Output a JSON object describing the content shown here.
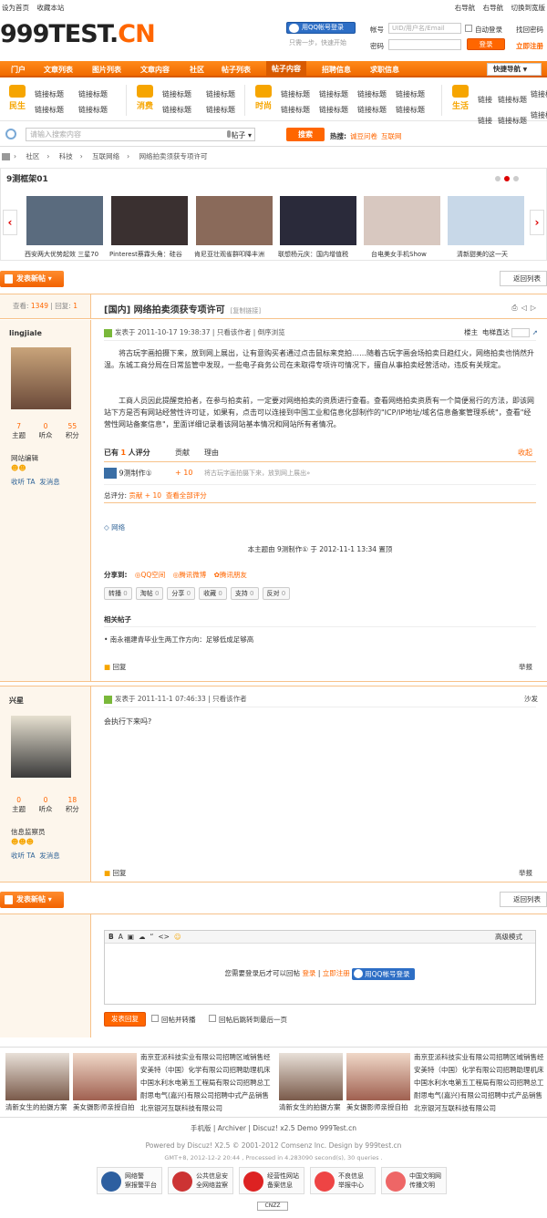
{
  "topbar": {
    "left": [
      "设为首页",
      "收藏本站"
    ],
    "right": [
      "右导航",
      "右导航",
      "切换到宽版"
    ]
  },
  "logo": {
    "main": "999TEST.",
    "accent": "CN"
  },
  "login": {
    "qq_button": "用QQ帐号登录",
    "qq_sub": "只需一步，快速开始",
    "account_label": "帐号",
    "account_placeholder": "UID/用户名/Email",
    "auto_login": "自动登录",
    "retrieve_password": "找回密码",
    "password_label": "密码",
    "login_button": "登录",
    "register": "立即注册"
  },
  "nav": {
    "items": [
      "门户",
      "文章列表",
      "图片列表",
      "文章内容",
      "社区",
      "帖子列表",
      "帖子内容",
      "招聘信息",
      "求职信息"
    ],
    "active_index": 6,
    "quick_nav": "快捷导航"
  },
  "categories": [
    {
      "name": "民生",
      "icon": "people-icon",
      "links": [
        "链接标题",
        "链接标题",
        "链接标题",
        "链接标题"
      ]
    },
    {
      "name": "消费",
      "icon": "cart-icon",
      "links": [
        "链接标题",
        "链接标题",
        "链接标题",
        "链接标题"
      ]
    },
    {
      "name": "时尚",
      "icon": "camera-icon",
      "links": [
        "链接标题",
        "链接标题",
        "链接标题",
        "链接标题",
        "链接标题",
        "链接标题",
        "链接标题",
        "链接标题"
      ]
    },
    {
      "name": "生活",
      "icon": "house-icon",
      "links": [
        "链接",
        "链接标题",
        "链接标题",
        "链接",
        "链接标题",
        "链接标题"
      ]
    }
  ],
  "search": {
    "placeholder": "请输入搜索内容",
    "type": "帖子",
    "button": "搜索",
    "hot_label": "热搜:",
    "hot": [
      "诚豆问卷",
      "互联网"
    ]
  },
  "breadcrumb": [
    "社区",
    "科技",
    "互联网络",
    "网络拍卖须获专项许可"
  ],
  "carousel": {
    "title": "9测框架01",
    "captions": [
      "西安两大优势起效 三星70",
      "Pinterest蔡霖头角：硅谷",
      "肯尼亚壮观雀群叩降丰洲",
      "联想杨元庆：国内增值税",
      "台电美女手机Show",
      "清新甜美的这一天"
    ],
    "thumb_colors": [
      "#5a6b7e",
      "#3a3030",
      "#8a6a5a",
      "#2a2a3a",
      "#d8c8c0",
      "#c8d8e8"
    ]
  },
  "actions": {
    "new_post": "发表新帖",
    "back_to_list": "返回列表"
  },
  "thread": {
    "views_label": "查看:",
    "views": "1349",
    "replies_label": "回复:",
    "replies": "1",
    "category": "[国内]",
    "title": "网络拍卖须获专项许可",
    "copy_link": "[复制链接]"
  },
  "post1": {
    "author": "lingjiale",
    "stats": [
      {
        "v": "7",
        "k": "主题"
      },
      {
        "v": "0",
        "k": "听众"
      },
      {
        "v": "55",
        "k": "积分"
      }
    ],
    "rank": "网站编辑",
    "follow": "收听 TA",
    "message": "发消息",
    "posted": "发表于 2011-10-17 19:38:37",
    "only_author": "只看该作者",
    "reverse": "倒序浏览",
    "floor": "楼主",
    "elevator": "电梯直达",
    "para1": "将古玩字画拍摄下来，放到网上展出，让有意购买者通过点击鼠标来竞拍……随着古玩字画会场拍卖日趋红火，网络拍卖也悄然升温。东城工商分局在日常监管中发现，一些电子商务公司在未取得专项许可情况下，擅自从事拍卖经营活动，违反有关规定。",
    "para2": "工商人员因此提醒竞拍者，在参与拍卖前，一定要对网络拍卖的资质进行查看。查看网络拍卖资质有一个简便易行的方法，即该网站下方是否有网站经营性许可证，如果有，点击可以连接到中国工业和信息化部制作的\"ICP/IP地址/域名信息备案管理系统\"，查看\"经营性网站备案信息\"，里面详细记录着该网站基本情况和网站所有者情况。",
    "rating_count_pre": "已有",
    "rating_count": "1",
    "rating_count_post": "人评分",
    "rating_col": "贡献",
    "reason_col": "理由",
    "collapse": "收起",
    "rater": "9测制作①",
    "rater_score": "+ 10",
    "rater_reason": "将古玩字画拍摄下来，放到网上展出»",
    "total_label": "总评分:",
    "total_value": "贡献 + 10",
    "view_all": "查看全部评分",
    "tag": "网络",
    "edited": "本主题由 9测制作① 于 2012-11-1 13:34 置顶",
    "share_label": "分享到:",
    "share": [
      "QQ空间",
      "腾讯微博",
      "腾讯朋友"
    ],
    "buttons": [
      {
        "l": "转播",
        "c": "0"
      },
      {
        "l": "淘帖",
        "c": "0"
      },
      {
        "l": "分享",
        "c": "0"
      },
      {
        "l": "收藏",
        "c": "0"
      },
      {
        "l": "支持",
        "c": "0"
      },
      {
        "l": "反对",
        "c": "0"
      }
    ],
    "related_title": "相关帖子",
    "related": "• 南永福建青毕业生两工作方向：足够低成足够高",
    "reply": "回复",
    "report": "举报"
  },
  "post2": {
    "author": "兴星",
    "stats": [
      {
        "v": "0",
        "k": "主题"
      },
      {
        "v": "0",
        "k": "听众"
      },
      {
        "v": "18",
        "k": "积分"
      }
    ],
    "rank": "信息监察员",
    "follow": "收听 TA",
    "message": "发消息",
    "posted": "发表于 2011-11-1 07:46:33",
    "only_author": "只看该作者",
    "floor": "沙发",
    "content": "会执行下来吗?",
    "reply": "回复",
    "report": "举报"
  },
  "editor": {
    "tools": [
      "B",
      "A",
      "▣",
      "☁",
      "“",
      "<>",
      "☺"
    ],
    "advanced": "高级模式",
    "need_login": "您需要登录后才可以回帖",
    "login": "登录",
    "sep": "|",
    "register": "立即注册",
    "qq_button": "用QQ帐号登录",
    "submit": "发表回复",
    "opt1": "回帖并转播",
    "opt2": "回帖后跳转到最后一页"
  },
  "ads": {
    "captions": [
      "清新女生的拍摄方案",
      "美女摄影师亲授自拍",
      "清新女生的拍摄方案",
      "美女摄影师亲授自拍"
    ],
    "text1": "南京亚派科技实业有限公司招聘区域销售经安美特（中国）化学有限公司招聘助理机床中国水利水电第五工程局有限公司招聘总工耐思电气(嘉兴)有限公司招聘中式产品销售北京银河互联科技有限公司",
    "text2": "南京亚派科技实业有限公司招聘区域销售经安美特（中国）化学有限公司招聘助理机床中国水利水电第五工程局有限公司招聘总工耐思电气(嘉兴)有限公司招聘中式产品销售北京银河互联科技有限公司"
  },
  "footer": {
    "links": "手机版 | Archiver | Discuz! x2.5 Demo 999Test.cn",
    "powered": "Powered by Discuz! X2.5 © 2001-2012 Comsenz Inc. Design by 999test.cn",
    "gmt": "GMT+8, 2012-12-2 20:44 , Processed in 4.283090 second(s), 30 queries .",
    "badges": [
      {
        "l1": "网络警",
        "l2": "察报警平台"
      },
      {
        "l1": "公共信息安",
        "l2": "全网络监察"
      },
      {
        "l1": "经营性网站",
        "l2": "备案信息"
      },
      {
        "l1": "不良信息",
        "l2": "举报中心"
      },
      {
        "l1": "中国文明网",
        "l2": "传播文明"
      }
    ],
    "cnzz": "CNZZ"
  }
}
